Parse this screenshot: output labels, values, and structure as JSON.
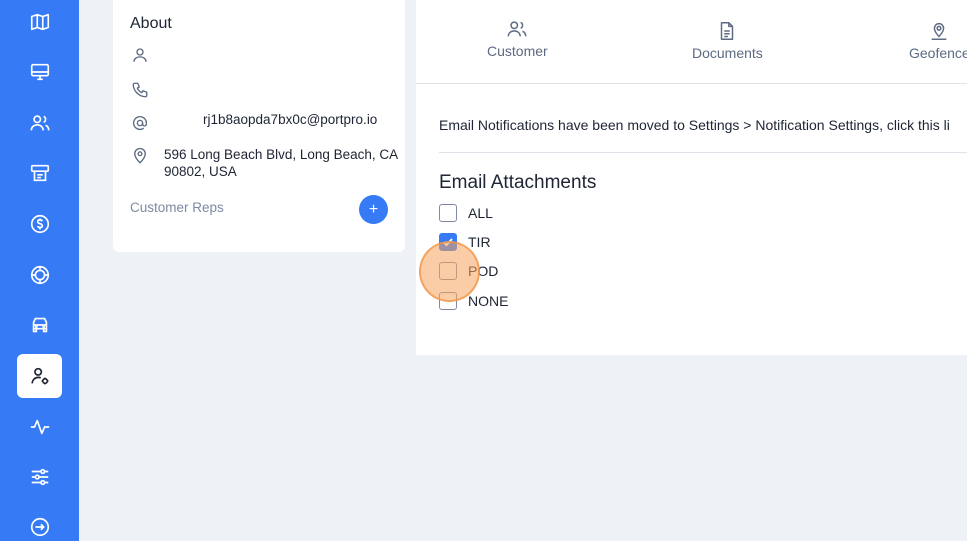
{
  "sidebar": {
    "items": [
      {
        "name": "map-icon"
      },
      {
        "name": "monitor-icon"
      },
      {
        "name": "users-icon"
      },
      {
        "name": "billing-icon"
      },
      {
        "name": "dollar-icon"
      },
      {
        "name": "globe-icon"
      },
      {
        "name": "truck-icon"
      },
      {
        "name": "user-settings-icon",
        "active": true
      },
      {
        "name": "activity-icon"
      },
      {
        "name": "sliders-icon"
      },
      {
        "name": "logout-icon"
      }
    ],
    "accent": "#367bf5"
  },
  "about": {
    "title": "About",
    "email": "rj1b8aopda7bx0c@portpro.io",
    "address": "596 Long Beach Blvd, Long Beach, CA 90802, USA",
    "reps_label": "Customer Reps",
    "add_rep_label": "+"
  },
  "tabs": [
    {
      "label": "Customer",
      "icon": "users-icon"
    },
    {
      "label": "Documents",
      "icon": "document-icon"
    },
    {
      "label": "Geofence",
      "icon": "location-icon"
    }
  ],
  "notice": "Email Notifications have been moved to Settings > Notification Settings, click this li",
  "attachments": {
    "title": "Email Attachments",
    "options": [
      {
        "label": "ALL",
        "checked": false
      },
      {
        "label": "TIR",
        "checked": true
      },
      {
        "label": "POD",
        "checked": false
      },
      {
        "label": "NONE",
        "checked": false
      }
    ]
  }
}
